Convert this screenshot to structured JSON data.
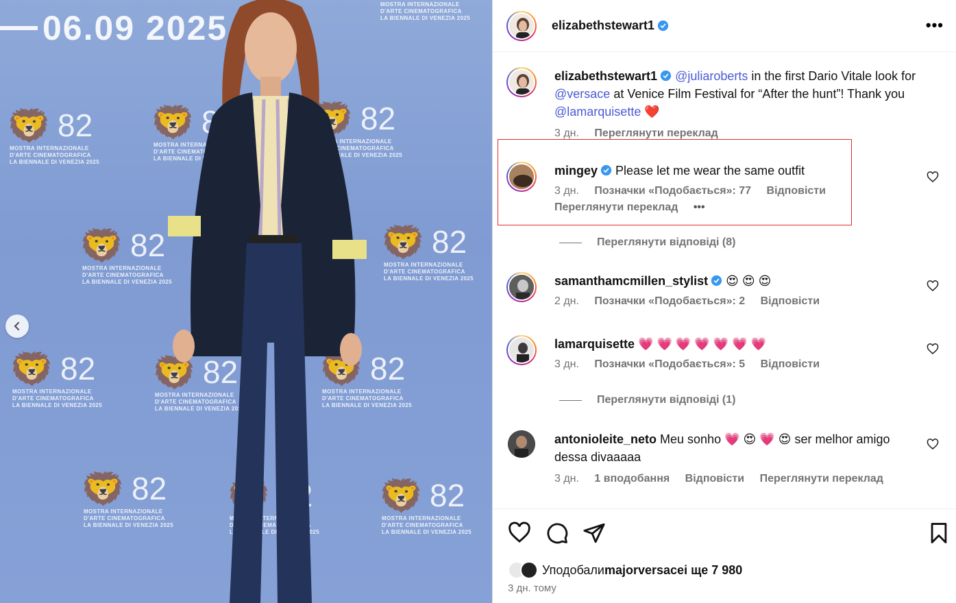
{
  "photo": {
    "banner_date": "— 06.09 2025",
    "logo_lines": [
      "MOSTRA INTERNAZIONALE",
      "D'ARTE CINEMATOGRAFICA",
      "LA BIENNALE DI VENEZIA 2025"
    ],
    "logo_number": "82",
    "prev_arrow": "‹"
  },
  "post": {
    "author": "elizabethstewart1",
    "more_icon": "•••",
    "caption": {
      "author": "elizabethstewart1",
      "mention1": "@juliaroberts",
      "text1": " in the first Dario Vitale look for ",
      "mention2": "@versace",
      "text2": " at Venice Film Festival for “After the hunt”! Thank you ",
      "mention3": "@lamarquisette",
      "emoji": "❤️",
      "time": "3 дн.",
      "translate": "Переглянути переклад"
    },
    "comments": [
      {
        "user": "mingey",
        "text": "Please let me wear the same outfit",
        "time": "3 дн.",
        "likes": "Позначки «Подобається»: 77",
        "reply": "Відповісти",
        "translate": "Переглянути переклад",
        "more": "•••"
      },
      {
        "user": "samanthamcmillen_stylist",
        "text": "😍 😍 😍",
        "time": "2 дн.",
        "likes": "Позначки «Подобається»: 2",
        "reply": "Відповісти"
      },
      {
        "user": "lamarquisette",
        "text": "💗 💗 💗 💗 💗 💗 💗",
        "time": "3 дн.",
        "likes": "Позначки «Подобається»: 5",
        "reply": "Відповісти"
      },
      {
        "user": "antonioleite_neto",
        "text": "Meu sonho 💗 😍 💗 😍 ser melhor amigo dessa divaaaaa",
        "time": "3 дн.",
        "likes": "1 вподобання",
        "reply": "Відповісти",
        "translate": "Переглянути переклад"
      }
    ],
    "view_replies": [
      "Переглянути відповіді (8)",
      "Переглянути відповіді (1)"
    ],
    "liked_by_prefix": "Уподобали ",
    "liked_by_user": "majorversace",
    "liked_by_suffix": " і ще 7 980",
    "posted": "3 дн. тому"
  }
}
